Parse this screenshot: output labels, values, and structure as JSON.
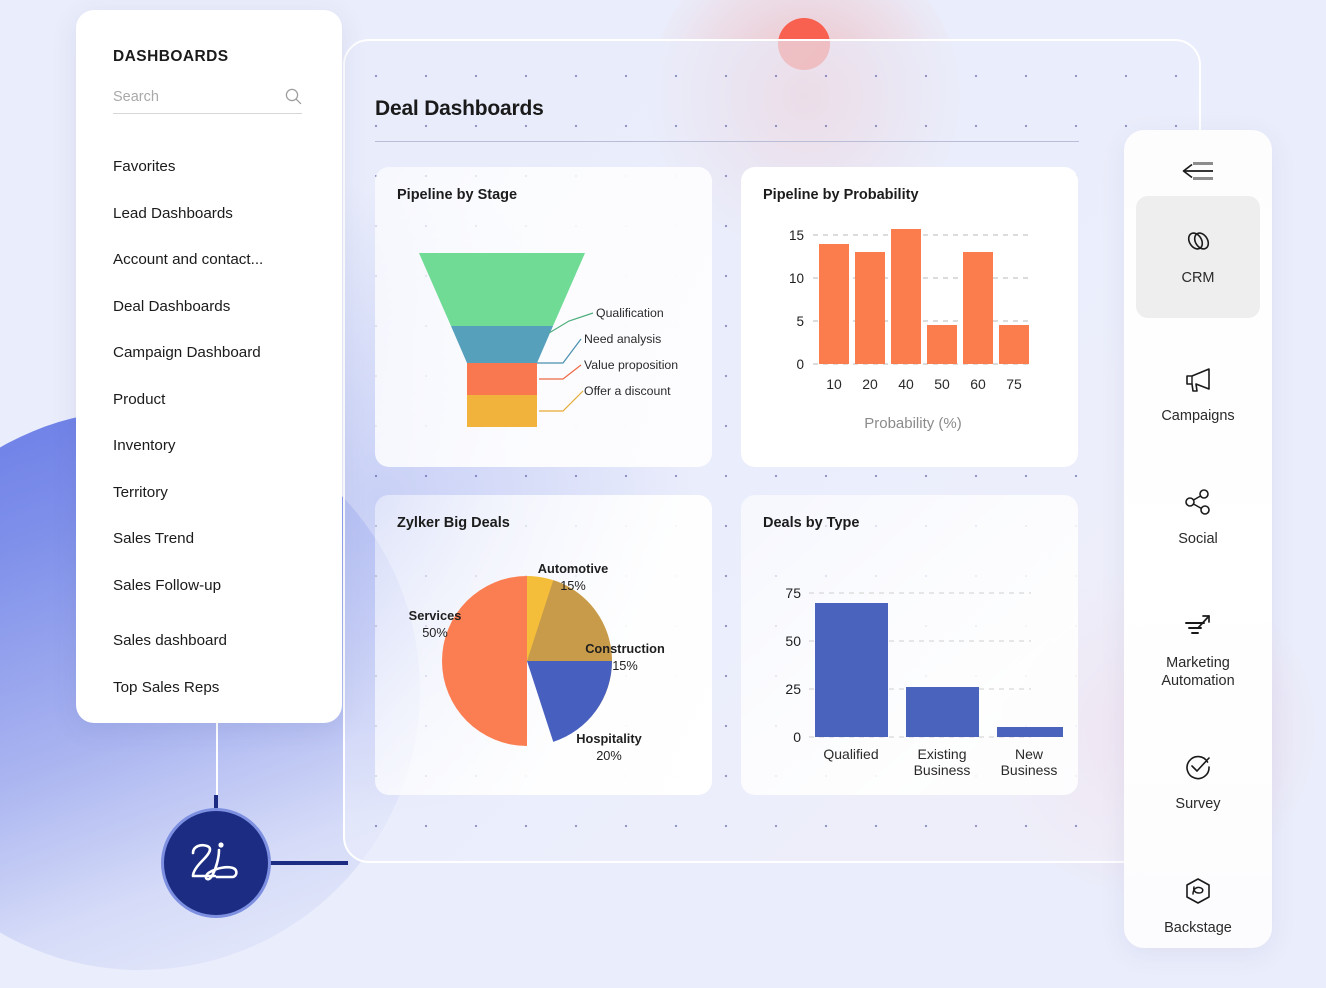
{
  "sidebar": {
    "heading": "DASHBOARDS",
    "search": {
      "placeholder": "Search",
      "value": "",
      "icon": "search-icon"
    },
    "items": [
      {
        "label": "Favorites"
      },
      {
        "label": "Lead Dashboards"
      },
      {
        "label": "Account and contact..."
      },
      {
        "label": "Deal Dashboards"
      },
      {
        "label": "Campaign Dashboard"
      },
      {
        "label": "Product"
      },
      {
        "label": "Inventory"
      },
      {
        "label": "Territory"
      },
      {
        "label": "Sales Trend"
      },
      {
        "label": "Sales Follow-up"
      },
      {
        "label": "Sales dashboard"
      },
      {
        "label": "Top Sales Reps"
      }
    ]
  },
  "assistant": {
    "name": "Zia",
    "icon": "zia-logo-icon"
  },
  "main": {
    "title": "Deal Dashboards"
  },
  "app_rail": {
    "collapse_icon": "collapse-left-icon",
    "items": [
      {
        "label": "CRM",
        "icon": "link-chain-icon",
        "active": true
      },
      {
        "label": "Campaigns",
        "icon": "megaphone-icon",
        "active": false
      },
      {
        "label": "Social",
        "icon": "share-nodes-icon",
        "active": false
      },
      {
        "label": "Marketing Automation",
        "icon": "trending-arrow-icon",
        "active": false
      },
      {
        "label": "Survey",
        "icon": "check-circle-icon",
        "active": false
      },
      {
        "label": "Backstage",
        "icon": "hexagon-icon",
        "active": false
      }
    ]
  },
  "colors": {
    "accent_blue": "#1b2c82",
    "background": "#eaedfb",
    "funnel_green": "#6fdb95",
    "funnel_teal": "#56a0bc",
    "funnel_orange": "#fa7850",
    "funnel_yellow": "#f2b33d",
    "bar_orange": "#fb7c4d",
    "bar_blue": "#4a63bc",
    "pie_yellow": "#f5be3a",
    "pie_tan": "#c89b4a",
    "pie_blue": "#4760bf",
    "pie_orange": "#fb7e52"
  },
  "chart_data": [
    {
      "type": "funnel",
      "title": "Pipeline by Stage",
      "categories": [
        "Qualification",
        "Need analysis",
        "Value proposition",
        "Offer a discount"
      ],
      "values": [
        100,
        45,
        22,
        22
      ],
      "colors": [
        "#6fdb95",
        "#56a0bc",
        "#fa7850",
        "#f2b33d"
      ],
      "legend_position": "right-callout"
    },
    {
      "type": "bar",
      "title": "Pipeline by Probability",
      "categories": [
        "10",
        "20",
        "40",
        "50",
        "60",
        "75"
      ],
      "values": [
        14,
        13,
        15.7,
        4.5,
        13,
        4.5
      ],
      "xlabel": "Probability (%)",
      "ylabel": "",
      "yticks": [
        0,
        5,
        10,
        15
      ],
      "ylim": [
        0,
        16.5
      ],
      "grid": true,
      "color": "#fb7c4d"
    },
    {
      "type": "pie",
      "title": "Zylker Big Deals",
      "categories": [
        "Automotive",
        "Construction",
        "Hospitality",
        "Services"
      ],
      "values": [
        15,
        15,
        20,
        50
      ],
      "labels": [
        "Automotive\n15%",
        "Construction\n15%",
        "Hospitality\n20%",
        "Services\n50%"
      ],
      "colors": [
        "#f5be3a",
        "#c89b4a",
        "#4760bf",
        "#fb7e52"
      ]
    },
    {
      "type": "bar",
      "title": "Deals by Type",
      "categories": [
        "Qualified",
        "Existing Business",
        "New Business"
      ],
      "values": [
        70,
        26,
        5
      ],
      "xlabel": "",
      "ylabel": "",
      "yticks": [
        0,
        25,
        50,
        75
      ],
      "ylim": [
        0,
        80
      ],
      "grid": true,
      "color": "#4a63bc"
    }
  ]
}
